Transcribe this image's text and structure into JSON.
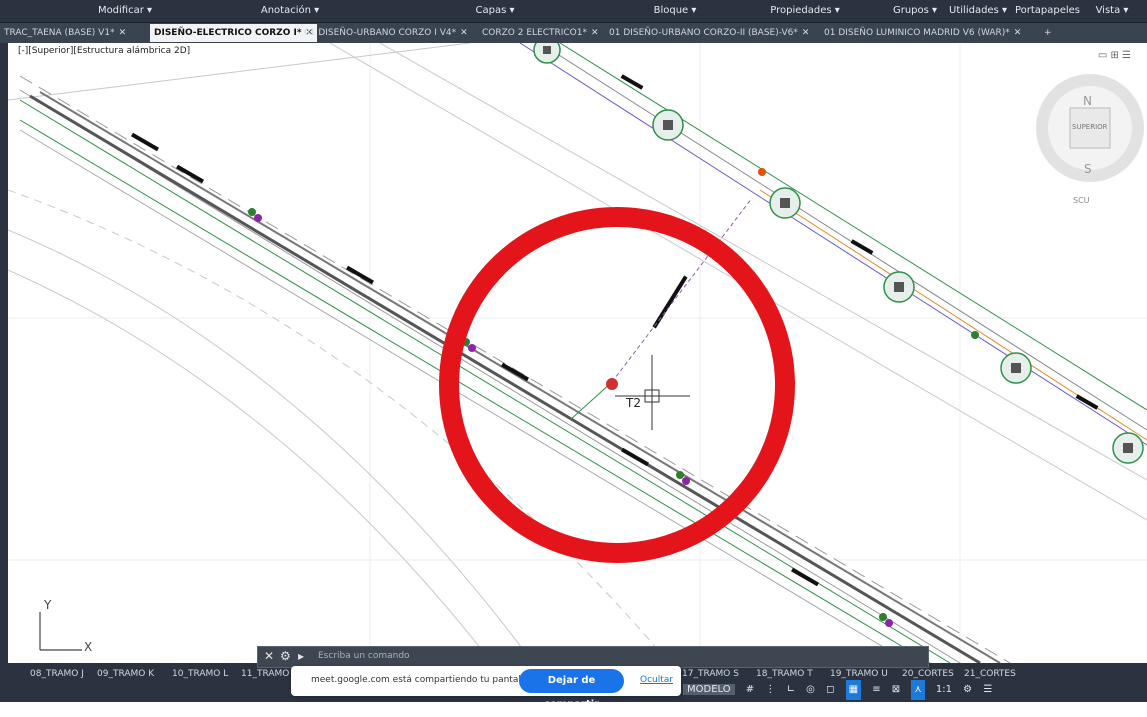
{
  "ribbon": {
    "sections": [
      "Modificar ▾",
      "Anotación ▾",
      "Capas ▾",
      "Bloque ▾",
      "Propiedades ▾",
      "Grupos ▾",
      "Utilidades ▾",
      "Portapapeles",
      "Vista ▾"
    ]
  },
  "tabs": [
    {
      "label": "TRAC_TAENA (BASE) V1*",
      "active": false
    },
    {
      "label": "DISEÑO-ELECTRICO CORZO I*",
      "active": true
    },
    {
      "label": "01 DISEÑO-URBANO CORZO I V4*",
      "active": false
    },
    {
      "label": "CORZO 2 ELECTRICO1*",
      "active": false
    },
    {
      "label": "01 DISEÑO-URBANO CORZO-II (BASE)-V6*",
      "active": false
    },
    {
      "label": "01 DISEÑO LUMINICO MADRID V6 (WAR)*",
      "active": false
    }
  ],
  "viewport": {
    "label": "[-][Superior][Estructura alámbrica 2D]",
    "viewcube": {
      "north": "N",
      "south": "S",
      "face": "SUPERIOR",
      "wcs": "SCU"
    },
    "ucs": {
      "x": "X",
      "y": "Y"
    },
    "annotation": "T2",
    "highlight_color": "#e4141b"
  },
  "command_line": {
    "placeholder": "Escriba un comando"
  },
  "layout_tabs": [
    "08_TRAMO J",
    "09_TRAMO K",
    "10_TRAMO L",
    "11_TRAMO",
    "17_TRAMO S",
    "18_TRAMO T",
    "19_TRAMO U",
    "20_CORTES",
    "21_CORTES"
  ],
  "share_banner": {
    "message": "meet.google.com está compartiendo tu pantalla.",
    "stop_label": "Dejar de compartir",
    "hide_label": "Ocultar"
  },
  "status_bar": {
    "model": "MODELO",
    "scale": "1:1"
  }
}
